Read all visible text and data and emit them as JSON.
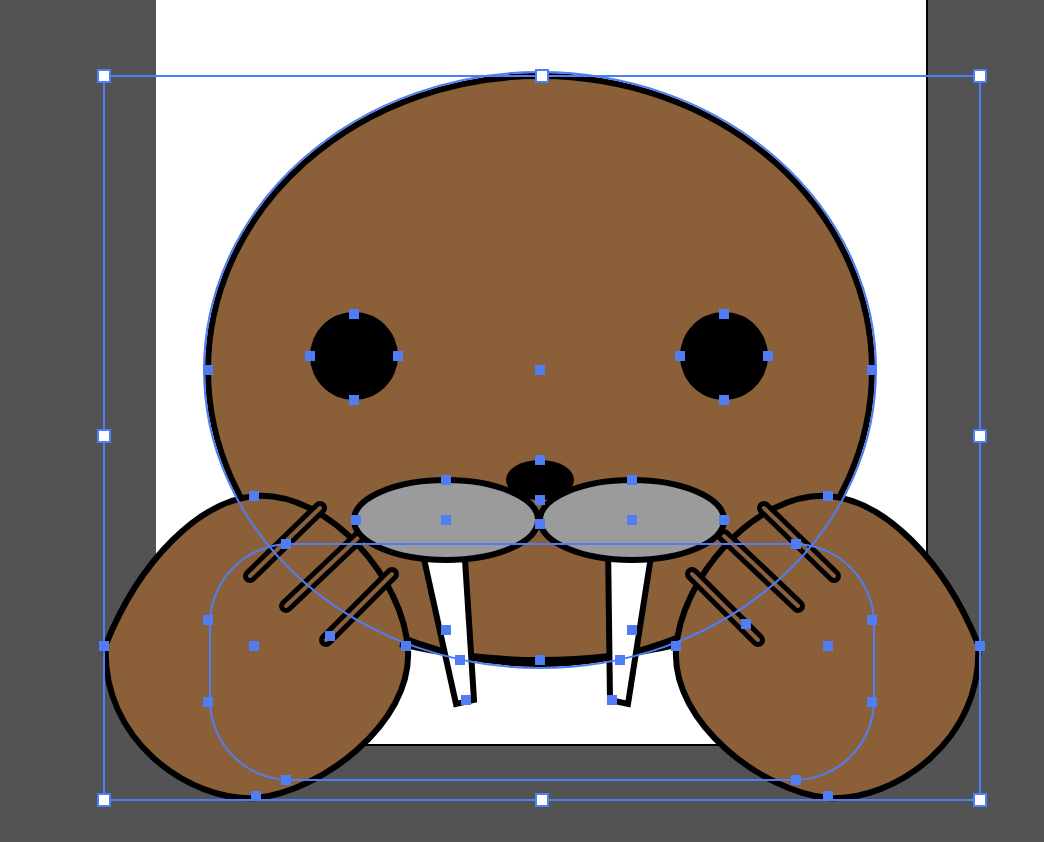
{
  "artwork": {
    "kind": "picture",
    "selected": true
  }
}
